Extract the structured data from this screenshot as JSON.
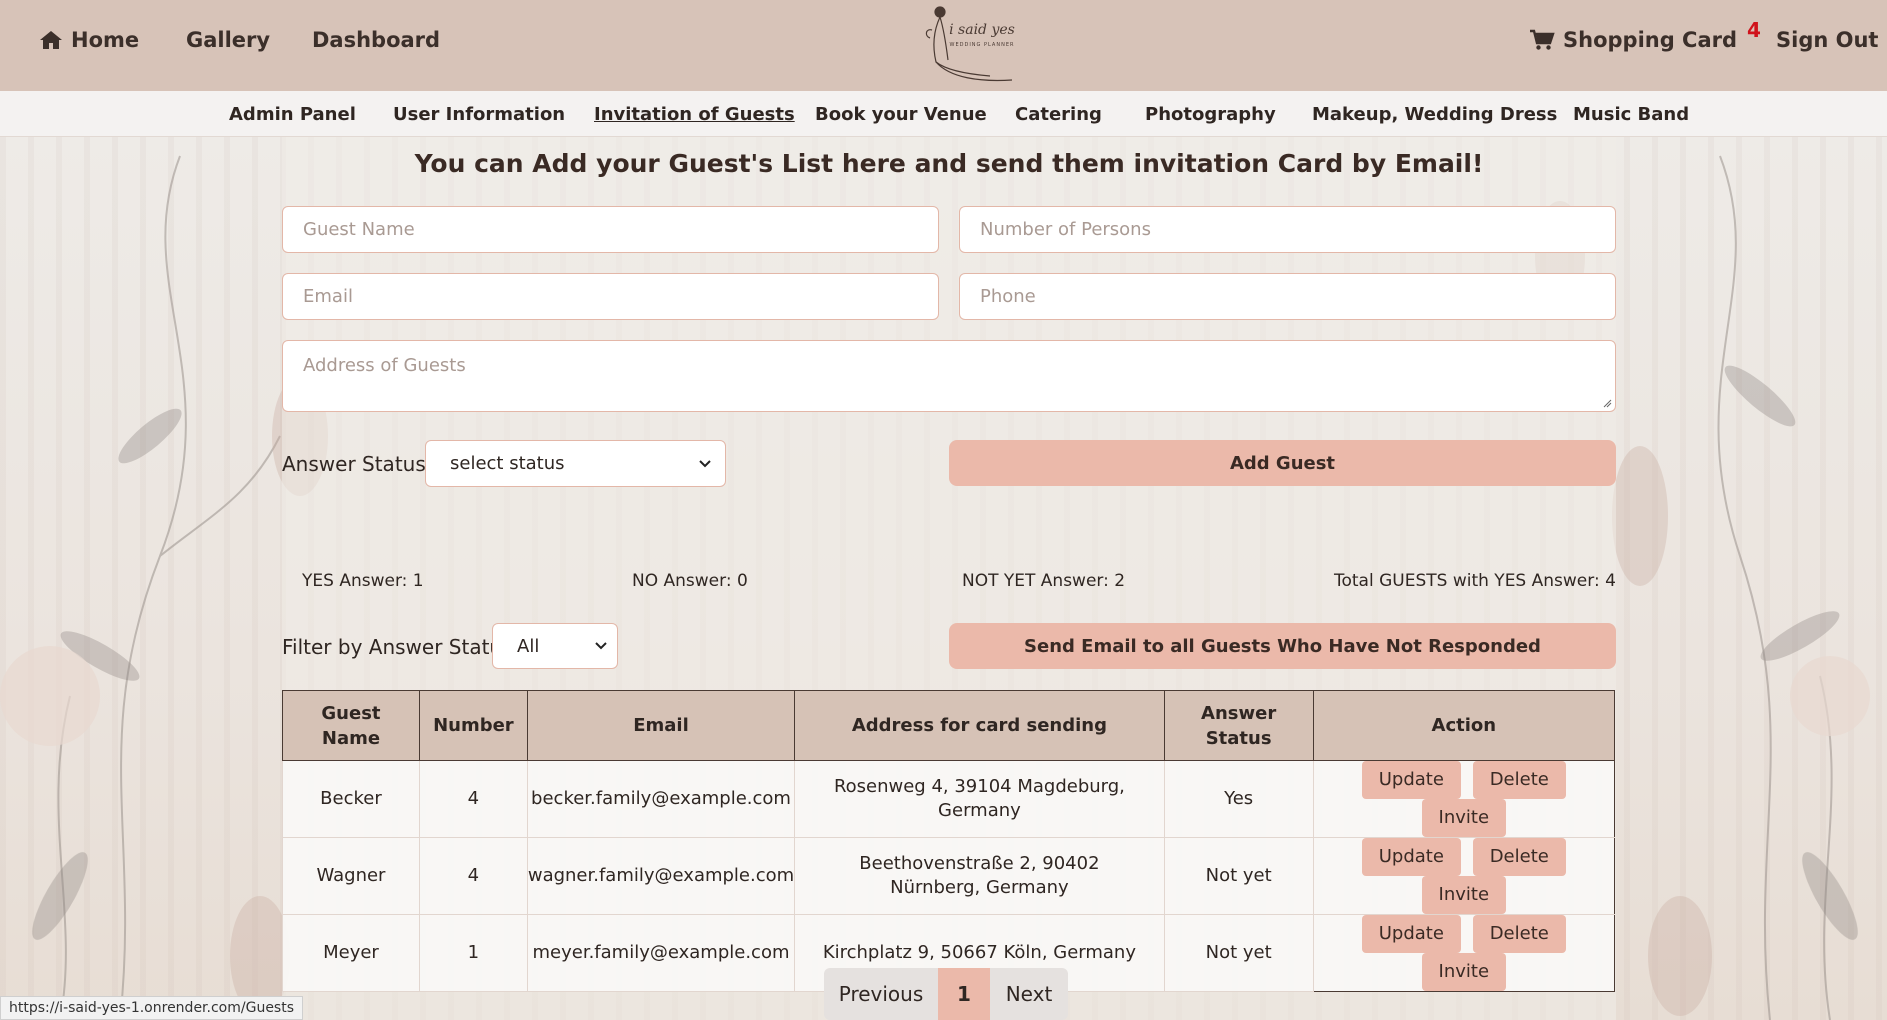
{
  "topnav": {
    "home": "Home",
    "gallery": "Gallery",
    "dashboard": "Dashboard",
    "cart": "Shopping Card",
    "cart_count": "4",
    "signout": "Sign Out"
  },
  "subnav": [
    "Admin Panel",
    "User Information",
    "Invitation of Guests",
    "Book your Venue",
    "Catering",
    "Photography",
    "Makeup, Wedding Dress",
    "Music Band"
  ],
  "heading": "You can Add your Guest's List here and send them invitation Card by Email!",
  "form": {
    "guest_name_ph": "Guest Name",
    "persons_ph": "Number of Persons",
    "email_ph": "Email",
    "phone_ph": "Phone",
    "address_ph": "Address of Guests",
    "answer_label": "Answer Status:",
    "answer_value": "select status",
    "add_button": "Add Guest"
  },
  "stats": {
    "yes": "YES Answer: 1",
    "no": "NO Answer: 0",
    "not_yet": "NOT YET Answer: 2",
    "total_yes": "Total GUESTS with YES Answer: 4"
  },
  "filter": {
    "label": "Filter by Answer Status:",
    "value": "All",
    "send_button": "Send Email to all Guests Who Have Not Responded"
  },
  "table": {
    "headers": [
      "Guest Name",
      "Number",
      "Email",
      "Address for card sending",
      "Answer Status",
      "Action"
    ],
    "rows": [
      {
        "name": "Becker",
        "number": "4",
        "email": "becker.family@example.com",
        "address": "Rosenweg 4, 39104 Magdeburg, Germany",
        "status": "Yes"
      },
      {
        "name": "Wagner",
        "number": "4",
        "email": "wagner.family@example.com",
        "address": "Beethovenstraße 2, 90402 Nürnberg, Germany",
        "status": "Not yet"
      },
      {
        "name": "Meyer",
        "number": "1",
        "email": "meyer.family@example.com",
        "address": "Kirchplatz 9, 50667 Köln, Germany",
        "status": "Not yet"
      }
    ],
    "actions": {
      "update": "Update",
      "delete": "Delete",
      "invite": "Invite"
    }
  },
  "pagination": {
    "previous": "Previous",
    "page": "1",
    "next": "Next"
  },
  "statusbar_url": "https://i-said-yes-1.onrender.com/Guests",
  "colors": {
    "nav_bg": "#d7c3b8",
    "button": "#ebb9aa",
    "cart_badge": "#d0121b"
  }
}
